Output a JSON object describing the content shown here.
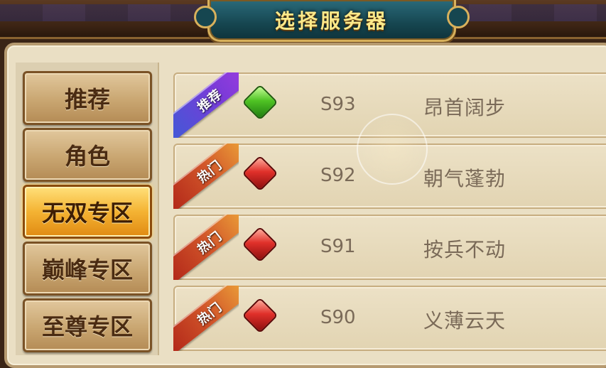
{
  "header": {
    "title": "选择服务器"
  },
  "sidebar": {
    "tabs": [
      {
        "label": "推荐",
        "active": false
      },
      {
        "label": "角色",
        "active": false
      },
      {
        "label": "无双专区",
        "active": true
      },
      {
        "label": "巅峰专区",
        "active": false
      },
      {
        "label": "至尊专区",
        "active": false
      }
    ]
  },
  "servers": [
    {
      "tag": "推荐",
      "tag_type": "recommend",
      "status_gem": "green",
      "id": "S93",
      "name": "昂首阔步"
    },
    {
      "tag": "热门",
      "tag_type": "hot",
      "status_gem": "red",
      "id": "S92",
      "name": "朝气蓬勃"
    },
    {
      "tag": "热门",
      "tag_type": "hot",
      "status_gem": "red",
      "id": "S91",
      "name": "按兵不动"
    },
    {
      "tag": "热门",
      "tag_type": "hot",
      "status_gem": "red",
      "id": "S90",
      "name": "义薄云天"
    }
  ],
  "colors": {
    "accent_gold": "#fde98a",
    "active_tab": "#f4b333",
    "gem_green": "#4fc324",
    "gem_red": "#e0302a"
  }
}
